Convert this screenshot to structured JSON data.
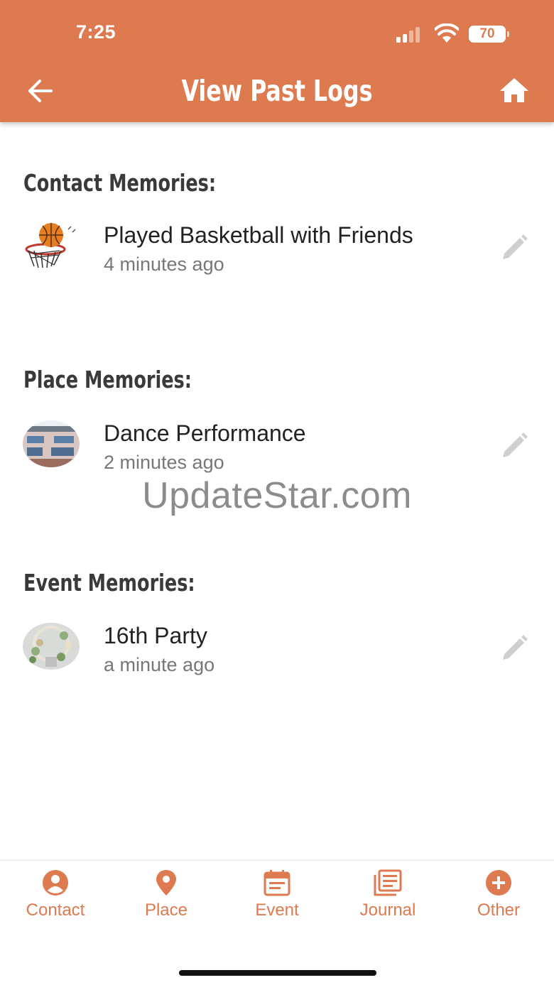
{
  "status_bar": {
    "time": "7:25",
    "battery": "70"
  },
  "header": {
    "title": "View Past Logs",
    "back_icon": "arrow-left-icon",
    "home_icon": "home-icon",
    "background_color": "#DE7A50"
  },
  "sections": [
    {
      "title": "Contact Memories:",
      "items": [
        {
          "title": "Played Basketball with Friends",
          "time": "4 minutes ago",
          "thumbnail": "basketball-image"
        }
      ]
    },
    {
      "title": "Place Memories:",
      "items": [
        {
          "title": "Dance Performance",
          "time": "2 minutes ago",
          "thumbnail": "building-image"
        }
      ]
    },
    {
      "title": "Event Memories:",
      "items": [
        {
          "title": "16th Party",
          "time": "a minute ago",
          "thumbnail": "party-decoration-image"
        }
      ]
    }
  ],
  "watermark": "UpdateStar.com",
  "bottom_nav": {
    "accent_color": "#DE7A50",
    "items": [
      {
        "label": "Contact",
        "icon": "person-circle-icon"
      },
      {
        "label": "Place",
        "icon": "map-pin-icon"
      },
      {
        "label": "Event",
        "icon": "calendar-icon"
      },
      {
        "label": "Journal",
        "icon": "journal-icon"
      },
      {
        "label": "Other",
        "icon": "plus-circle-icon"
      }
    ]
  }
}
